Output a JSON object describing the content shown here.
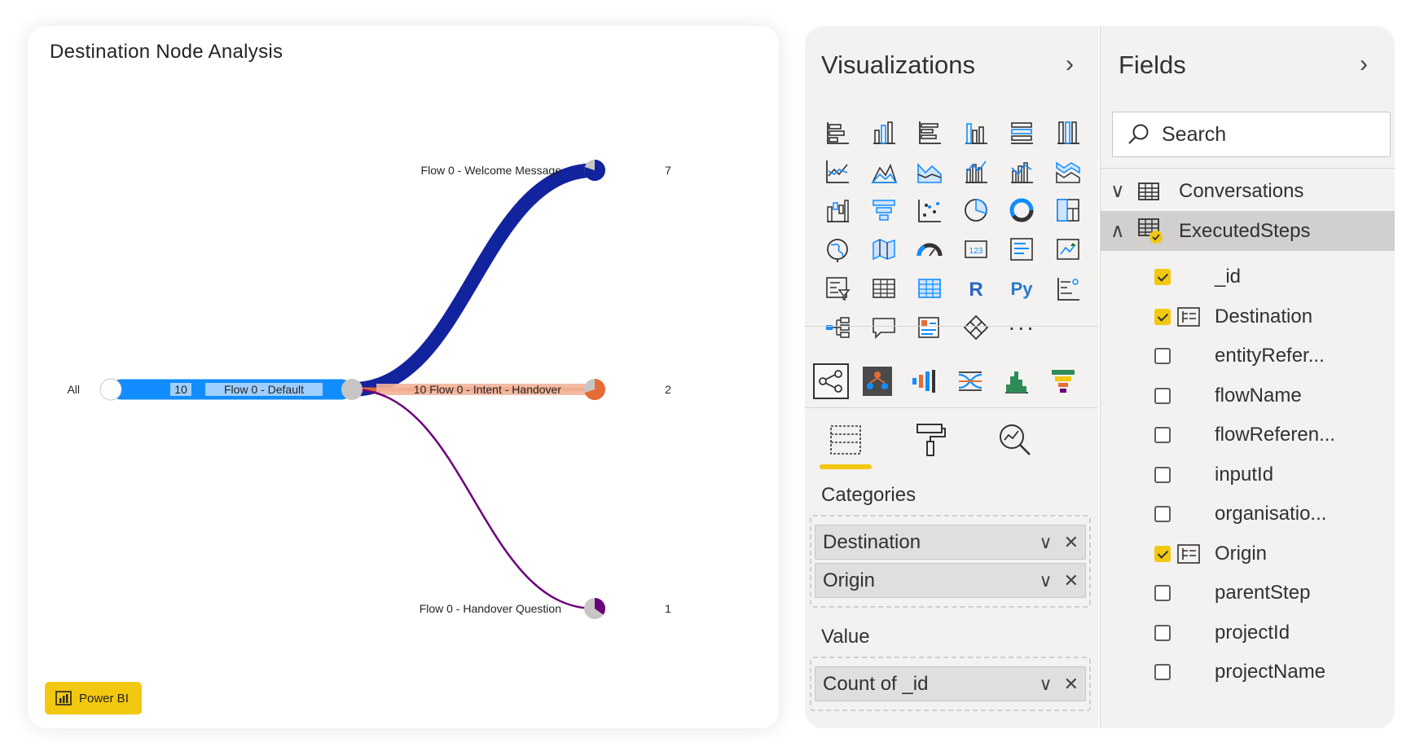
{
  "visual": {
    "title": "Destination Node Analysis",
    "badge_label": "Power BI",
    "sankey": {
      "root_label": "All",
      "source_node": {
        "label": "Flow 0 - Default",
        "value": 10,
        "value_label": "10",
        "color": "#118dff"
      },
      "links": [
        {
          "target": "Flow 0 - Welcome Message",
          "value": 7,
          "color": "#12239e"
        },
        {
          "target": "Flow 0 - Intent - Handover",
          "value": 2,
          "color": "#e66c37",
          "prefix": "10"
        },
        {
          "target": "Flow 0 - Handover Question",
          "value": 1,
          "color": "#6b007b"
        }
      ]
    }
  },
  "visualizations": {
    "title": "Visualizations",
    "collapse_icon": "chevron-right-icon",
    "more_label": "···",
    "tabs": [
      "build-visual-icon",
      "format-visual-icon",
      "analytics-icon"
    ],
    "categories_label": "Categories",
    "category_fields": [
      "Destination",
      "Origin"
    ],
    "value_label": "Value",
    "value_fields": [
      "Count of _id"
    ]
  },
  "fields": {
    "title": "Fields",
    "collapse_icon": "chevron-right-icon",
    "search_placeholder": "Search",
    "tables": [
      {
        "name": "Conversations",
        "expanded": false
      },
      {
        "name": "ExecutedSteps",
        "expanded": true
      }
    ],
    "items": [
      {
        "name": "_id",
        "checked": true,
        "hierarchy": false
      },
      {
        "name": "Destination",
        "checked": true,
        "hierarchy": true
      },
      {
        "name": "entityRefer...",
        "checked": false,
        "hierarchy": false
      },
      {
        "name": "flowName",
        "checked": false,
        "hierarchy": false
      },
      {
        "name": "flowReferen...",
        "checked": false,
        "hierarchy": false
      },
      {
        "name": "inputId",
        "checked": false,
        "hierarchy": false
      },
      {
        "name": "organisatio...",
        "checked": false,
        "hierarchy": false
      },
      {
        "name": "Origin",
        "checked": true,
        "hierarchy": true
      },
      {
        "name": "parentStep",
        "checked": false,
        "hierarchy": false
      },
      {
        "name": "projectId",
        "checked": false,
        "hierarchy": false
      },
      {
        "name": "projectName",
        "checked": false,
        "hierarchy": false
      }
    ]
  },
  "colors": {
    "accent": "#f2c811",
    "pane_bg": "#f3f2f1"
  }
}
